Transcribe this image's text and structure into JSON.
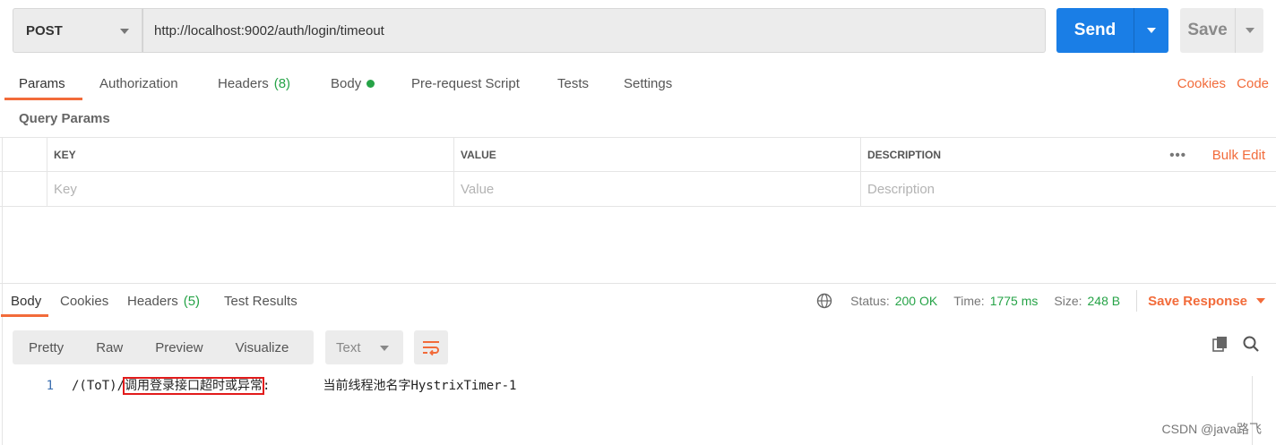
{
  "request": {
    "method": "POST",
    "url": "http://localhost:9002/auth/login/timeout",
    "send_label": "Send",
    "save_label": "Save"
  },
  "request_tabs": {
    "params": "Params",
    "authorization": "Authorization",
    "headers": "Headers",
    "headers_count": "(8)",
    "body": "Body",
    "pre_request": "Pre-request Script",
    "tests": "Tests",
    "settings": "Settings",
    "cookies": "Cookies",
    "code": "Code"
  },
  "query_params": {
    "label": "Query Params",
    "columns": {
      "key": "KEY",
      "value": "VALUE",
      "description": "DESCRIPTION"
    },
    "placeholders": {
      "key": "Key",
      "value": "Value",
      "description": "Description"
    },
    "more": "•••",
    "bulk_edit": "Bulk Edit"
  },
  "response_tabs": {
    "body": "Body",
    "cookies": "Cookies",
    "headers": "Headers",
    "headers_count": "(5)",
    "test_results": "Test Results"
  },
  "response_status": {
    "status_label": "Status:",
    "status_value": "200 OK",
    "time_label": "Time:",
    "time_value": "1775 ms",
    "size_label": "Size:",
    "size_value": "248 B",
    "save_response": "Save Response"
  },
  "format": {
    "pretty": "Pretty",
    "raw": "Raw",
    "preview": "Preview",
    "visualize": "Visualize",
    "type": "Text"
  },
  "response_body": {
    "line_number": "1",
    "prefix": "/(ToT)/",
    "highlighted": "调用登录接口超时或异常",
    "suffix": ":       当前线程池名字HystrixTimer-1"
  },
  "watermark": "CSDN @java路飞",
  "colors": {
    "accent": "#f26b3a",
    "send": "#1a7ee6",
    "success": "#26a347"
  }
}
